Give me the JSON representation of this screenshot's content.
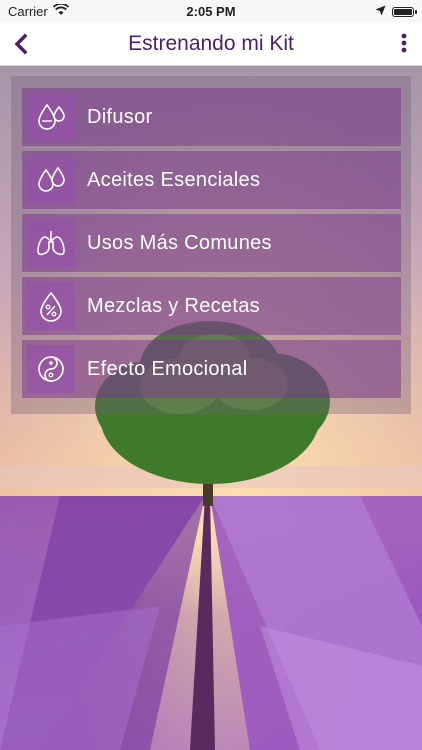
{
  "status_bar": {
    "carrier": "Carrier",
    "time": "2:05 PM"
  },
  "nav": {
    "title": "Estrenando mi Kit",
    "back_icon": "chevron-left-icon",
    "more_icon": "more-vertical-icon"
  },
  "colors": {
    "accent": "#4a1f6b",
    "item_bg": "#7c3c8c",
    "icon_bg": "#9650aa"
  },
  "menu": {
    "items": [
      {
        "label": "Difusor",
        "icon": "diffuser-drops-icon"
      },
      {
        "label": "Aceites Esenciales",
        "icon": "oil-drops-icon"
      },
      {
        "label": "Usos Más Comunes",
        "icon": "lungs-icon"
      },
      {
        "label": "Mezclas y Recetas",
        "icon": "percent-drop-icon"
      },
      {
        "label": "Efecto Emocional",
        "icon": "yin-yang-icon"
      }
    ]
  }
}
